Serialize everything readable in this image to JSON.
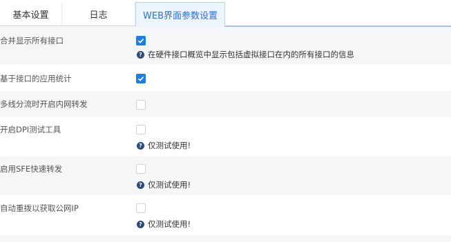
{
  "tabs": [
    {
      "label": "基本设置",
      "active": false
    },
    {
      "label": "日志",
      "active": false
    },
    {
      "label": "WEB界面参数设置",
      "active": true
    }
  ],
  "settings": [
    {
      "label": "合并显示所有接口",
      "checked": true,
      "hint": "在硬件接口概览中显示包括虚拟接口在内的所有接口的信息"
    },
    {
      "label": "基于接口的应用统计",
      "checked": true,
      "hint": ""
    },
    {
      "label": "多线分流时开启内网转发",
      "checked": false,
      "hint": ""
    },
    {
      "label": "开启DPI测试工具",
      "checked": false,
      "hint": "仅测试使用!"
    },
    {
      "label": "启用SFE快速转发",
      "checked": false,
      "hint": "仅测试使用!"
    },
    {
      "label": "自动重拨以获取公网IP",
      "checked": false,
      "hint": "仅测试使用!"
    }
  ],
  "icons": {
    "checkbox_checked": "check-icon",
    "hint": "question-circle-icon"
  },
  "colors": {
    "accent": "#1e7fe0",
    "active_tab_text": "#2c6fd1",
    "row_shade": "#f5f6f8",
    "hint_icon": "#2b4a78"
  }
}
